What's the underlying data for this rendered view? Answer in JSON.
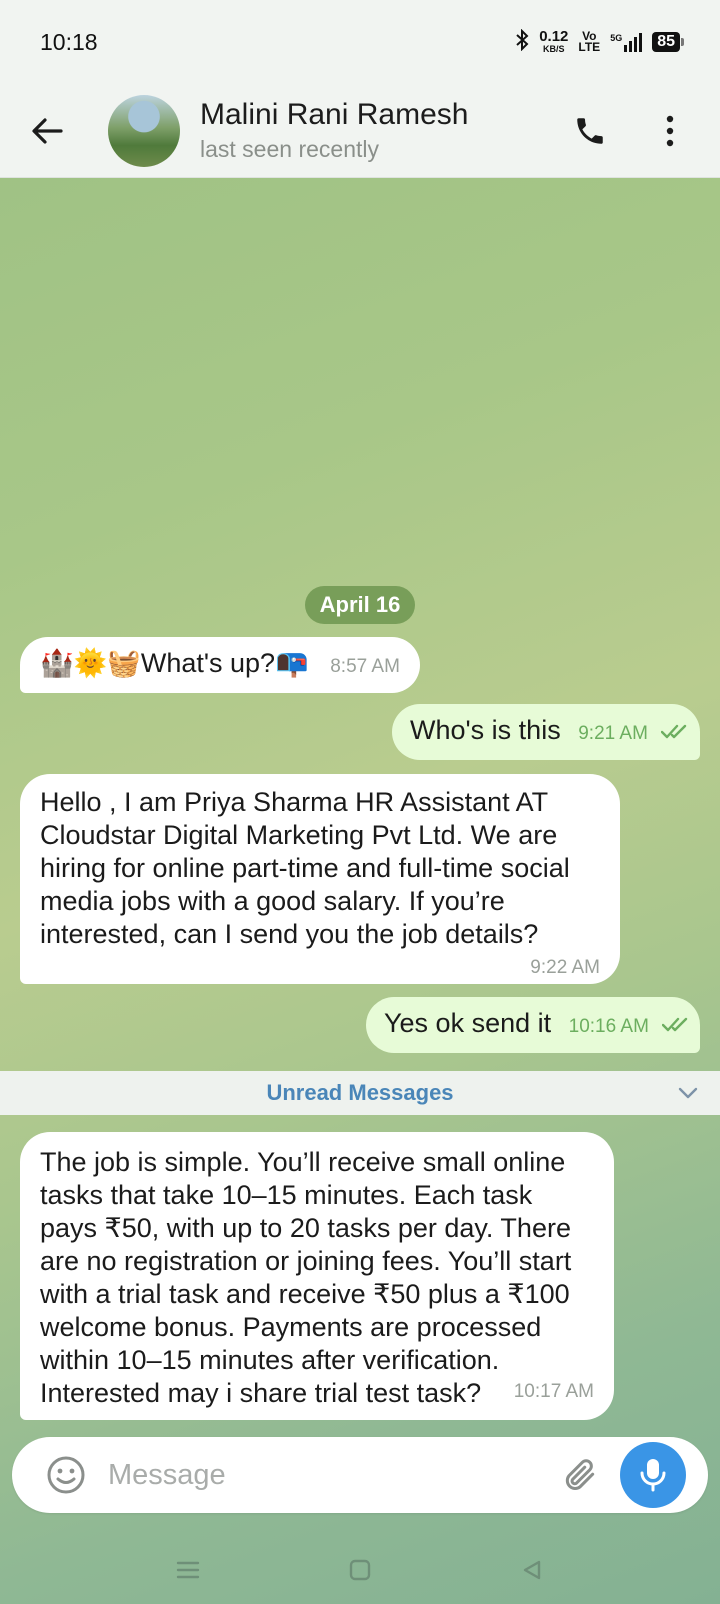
{
  "status_bar": {
    "time": "10:18",
    "net_speed_value": "0.12",
    "net_speed_unit": "KB/S",
    "volte_top": "Vo",
    "volte_bottom": "LTE",
    "network": "5G",
    "battery": "85"
  },
  "header": {
    "contact_name": "Malini Rani Ramesh",
    "contact_status": "last seen recently",
    "icons": [
      "back-arrow-icon",
      "phone-icon",
      "more-vertical-icon"
    ]
  },
  "chat": {
    "date_label": "April 16",
    "messages": [
      {
        "direction": "in",
        "text": "🏰🌞🧺What's up?📭",
        "time": "8:57 AM"
      },
      {
        "direction": "out",
        "text": "Who's is this",
        "time": "9:21 AM",
        "status": "read"
      },
      {
        "direction": "in",
        "text": "Hello , I am Priya Sharma HR Assistant AT Cloudstar Digital Marketing Pvt Ltd. We are hiring for online part-time and full-time social media jobs with a good salary. If you’re interested, can I send you the job details?",
        "time": "9:22 AM"
      },
      {
        "direction": "out",
        "text": "Yes ok send it",
        "time": "10:16 AM",
        "status": "read"
      },
      {
        "direction": "in",
        "text": "The job is simple. You’ll receive small online tasks that take 10–15 minutes. Each task pays ₹50, with up to 20 tasks per day. There are no registration or joining fees. You’ll start with a trial task and receive ₹50 plus a ₹100 welcome bonus. Payments are processed within 10–15 minutes after verification. Interested may i share trial test task?",
        "time": "10:17 AM"
      }
    ],
    "unread_label": "Unread Messages"
  },
  "composer": {
    "placeholder": "Message",
    "icons": [
      "emoji-icon",
      "attach-icon",
      "microphone-icon"
    ]
  },
  "colors": {
    "accent": "#3a95e6",
    "outgoing_bubble": "#e7fbd7",
    "incoming_bubble": "#ffffff",
    "read_check": "#6cae5f",
    "unread_text": "#4a86b8"
  }
}
